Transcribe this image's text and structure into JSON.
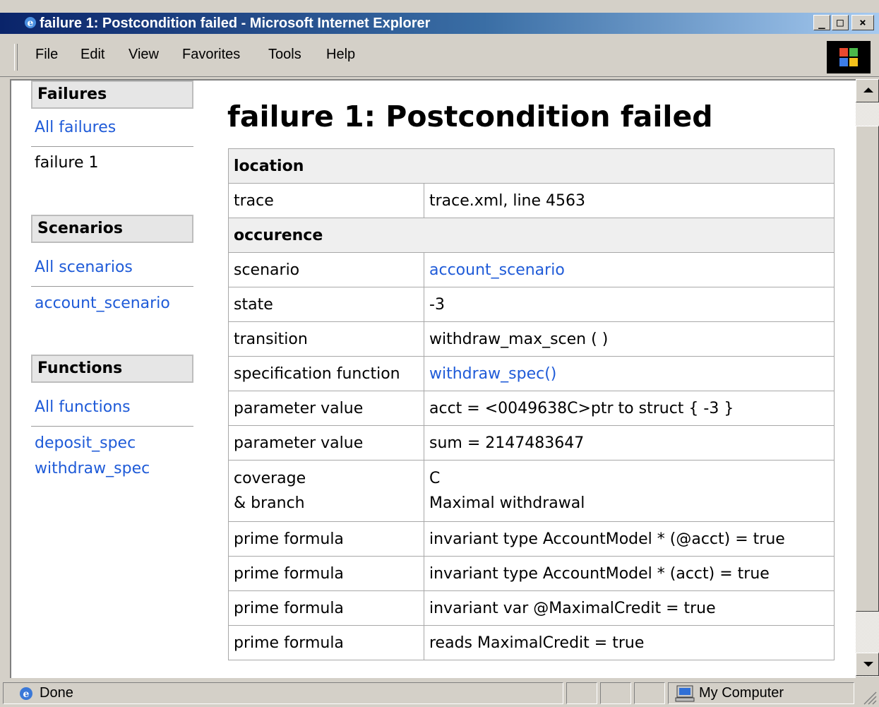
{
  "window": {
    "title": "failure 1: Postcondition failed - Microsoft Internet Explorer",
    "controls": {
      "minimize": "_",
      "maximize": "□",
      "close": "×"
    }
  },
  "menubar": {
    "items": [
      {
        "label": "File",
        "icon": "file"
      },
      {
        "label": "Edit"
      },
      {
        "label": "View"
      },
      {
        "label": "Favorites"
      },
      {
        "label": "Tools"
      },
      {
        "label": "Help"
      }
    ],
    "throbber_icon": "windows-logo-icon"
  },
  "sidebar": {
    "failures": {
      "heading": "Failures",
      "all_link": "All failures",
      "items": [
        "failure 1"
      ]
    },
    "scenarios": {
      "heading": "Scenarios",
      "all_link": "All scenarios",
      "items": [
        "account_scenario"
      ]
    },
    "functions": {
      "heading": "Functions",
      "all_link": "All functions",
      "items": [
        "deposit_spec",
        "withdraw_spec"
      ]
    }
  },
  "main": {
    "title": "failure 1: Postcondition failed",
    "sections": [
      {
        "heading": "location",
        "rows": [
          {
            "key": "trace",
            "value": "trace.xml, line 4563"
          }
        ]
      },
      {
        "heading": "occurence",
        "rows": [
          {
            "key": "scenario",
            "value": "account_scenario",
            "link": true
          },
          {
            "key": "state",
            "value": "-3"
          },
          {
            "key": "transition",
            "value": "withdraw_max_scen ( )"
          },
          {
            "key": "specification function",
            "value": "withdraw_spec()",
            "link": true
          },
          {
            "key": "parameter value",
            "value": "acct = <0049638C>ptr to struct { -3 }"
          },
          {
            "key": "parameter value",
            "value": "sum = 2147483647"
          },
          {
            "key": "coverage",
            "key2": "& branch",
            "value": "C",
            "value2": "Maximal withdrawal"
          },
          {
            "key": "prime formula",
            "value": "invariant type AccountModel * (@acct) = true"
          },
          {
            "key": "prime formula",
            "value": "invariant type AccountModel * (acct) = true"
          },
          {
            "key": "prime formula",
            "value": "invariant var @MaximalCredit = true"
          },
          {
            "key": "prime formula",
            "value": "reads MaximalCredit = true"
          }
        ]
      }
    ]
  },
  "statusbar": {
    "status": "Done",
    "zone": "My Computer"
  },
  "colors": {
    "link": "#1f5bd8",
    "title_gradient_start": "#0a246a",
    "title_gradient_end": "#a6caf0",
    "section_bg": "#efefef",
    "chrome": "#d4d0c8"
  }
}
